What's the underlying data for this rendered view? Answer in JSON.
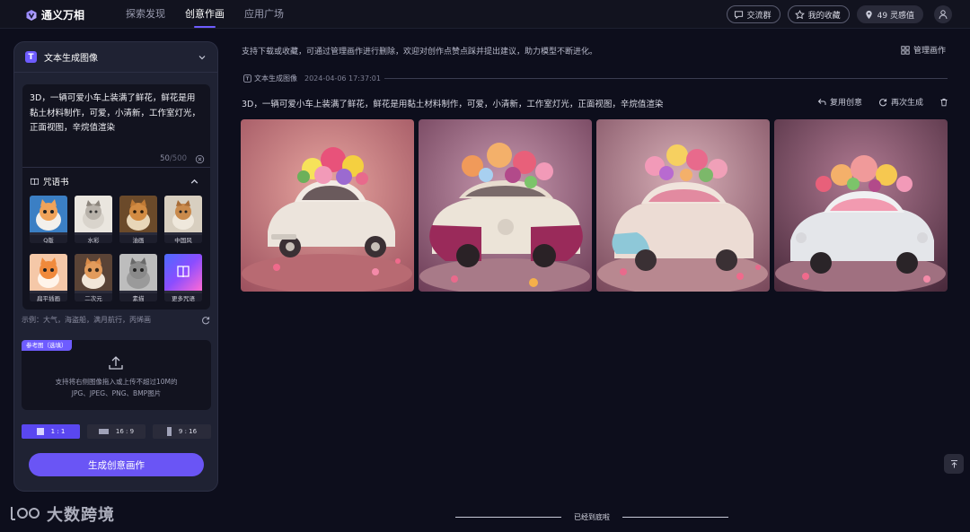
{
  "app": {
    "name": "通义万相"
  },
  "nav": {
    "items": [
      "探索发现",
      "创意作画",
      "应用广场"
    ],
    "active_index": 1
  },
  "top_actions": {
    "group": "交流群",
    "favorites": "我的收藏",
    "credits": "49 灵感值"
  },
  "panel": {
    "title": "文本生成图像",
    "prompt": "3D，一辆可爱小车上装满了鲜花，鲜花是用黏土材料制作，可爱，小清新，工作室灯光，正面视图，辛烷值渲染",
    "char_count": "50",
    "char_max": "/500",
    "spellbook_title": "咒语书",
    "styles": [
      "Q版",
      "水彩",
      "油画",
      "中国风",
      "扁平插画",
      "二次元",
      "素描",
      "更多咒语"
    ],
    "example": "示例：大气，海盗船，满月航行，丙烯画",
    "reference_tag": "参考图（选填）",
    "upload_hint_1": "支持将右侧图像拖入或上传不超过10M的",
    "upload_hint_2": "JPG、JPEG、PNG、BMP图片",
    "ratios": [
      "1 : 1",
      "16 : 9",
      "9 : 16"
    ],
    "active_ratio": "1 : 1",
    "generate_label": "生成创意画作"
  },
  "main": {
    "tip": "支持下载或收藏，可通过管理画作进行删除，欢迎对创作点赞点踩并提出建议，助力模型不断进化。",
    "manage_label": "管理画作",
    "record": {
      "type_label": "文本生成图像",
      "timestamp": "2024-04-06 17:37:01",
      "prompt": "3D，一辆可爱小车上装满了鲜花，鲜花是用黏土材料制作，可爱，小清新，工作室灯光，正面视图，辛烷值渲染",
      "reuse_label": "复用创意",
      "regenerate_label": "再次生成"
    },
    "end_text": "已经到底啦"
  },
  "watermark": {
    "text": "大数跨境"
  },
  "colors": {
    "accent": "#6e5cff",
    "background": "#0d0e1c",
    "panel": "#1f2233"
  }
}
